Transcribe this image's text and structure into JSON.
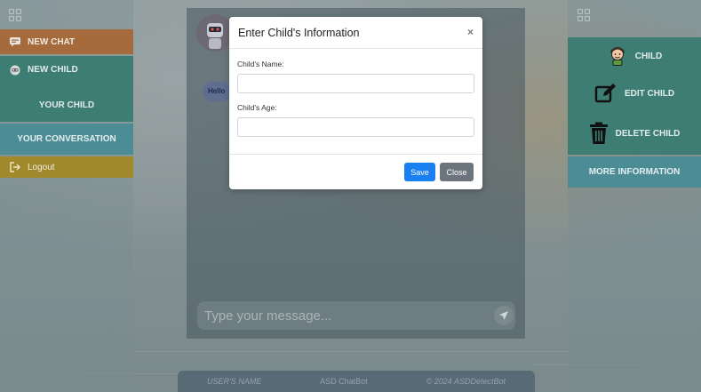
{
  "left_sidebar": {
    "new_chat": "NEW CHAT",
    "new_child": "NEW CHILD",
    "your_child": "YOUR CHILD",
    "your_conversation": "YOUR CONVERSATION",
    "logout": "Logout"
  },
  "right_sidebar": {
    "child": "CHILD",
    "edit_child": "EDIT CHILD",
    "delete_child": "DELETE CHILD",
    "more_information": "MORE INFORMATION"
  },
  "chat": {
    "greeting": "Hello",
    "input_placeholder": "Type your message..."
  },
  "modal": {
    "title": "Enter Child's Information",
    "close_glyph": "×",
    "name_label": "Child's Name:",
    "name_value": "",
    "age_label": "Child's Age:",
    "age_value": "",
    "save_label": "Save",
    "close_label": "Close"
  },
  "footer": {
    "user_name": "USER'S NAME",
    "app_name": "ASD ChatBot",
    "copyright": "© 2024 ASDDetectBot"
  },
  "colors": {
    "sidebar_teal": "#3e7d74",
    "new_chat_orange": "#a66b3c",
    "logout_gold": "#a0892d",
    "save_blue": "#1a7ff0",
    "close_gray": "#6c757d"
  },
  "icons": [
    "grid-icon",
    "chat-icon",
    "robot-icon",
    "logout-icon",
    "child-icon",
    "edit-icon",
    "trash-icon",
    "send-icon"
  ]
}
